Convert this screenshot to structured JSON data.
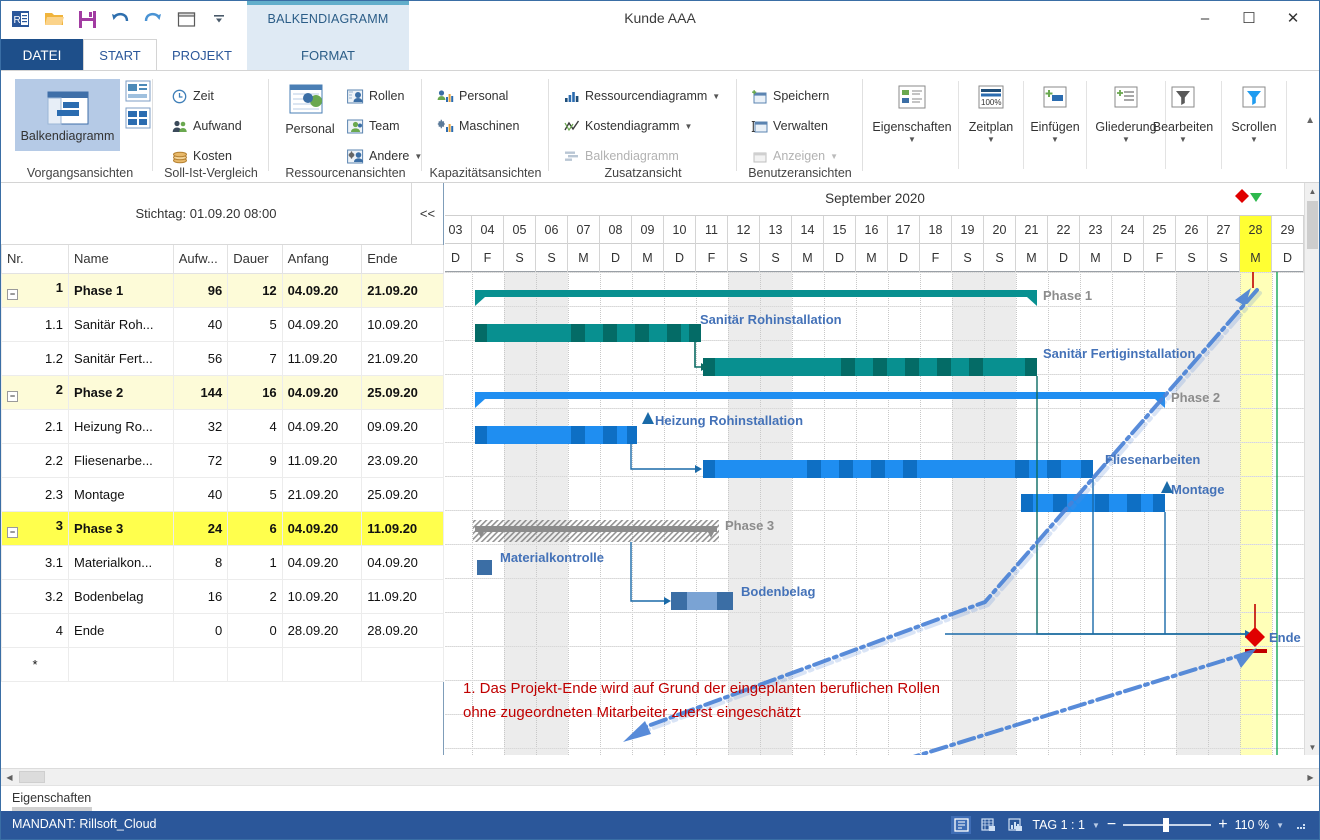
{
  "window": {
    "title": "Kunde AAA",
    "minimize": "–",
    "maximize": "☐",
    "close": "✕"
  },
  "quick_access": [
    {
      "name": "app-logo-icon",
      "label": "R"
    },
    {
      "name": "open-icon",
      "label": "Open"
    },
    {
      "name": "save-icon",
      "label": "Save"
    },
    {
      "name": "undo-icon",
      "label": "Undo"
    },
    {
      "name": "redo-icon",
      "label": "Redo"
    },
    {
      "name": "window-icon",
      "label": "Window"
    },
    {
      "name": "qat-more-icon",
      "label": "More"
    }
  ],
  "context_tab_group": "BALKENDIAGRAMM",
  "tabs": [
    {
      "label": "DATEI",
      "state": "file"
    },
    {
      "label": "START",
      "state": "active"
    },
    {
      "label": "PROJEKT",
      "state": "normal"
    },
    {
      "label": "FORMAT",
      "state": "context"
    }
  ],
  "ribbon": {
    "groups": [
      {
        "label": "Vorgangsansichten",
        "big": [
          {
            "label": "Balkendiagramm",
            "icon": "gantt-chart-icon",
            "selected": true
          }
        ],
        "small": []
      },
      {
        "label": "Soll-Ist-Vergleich",
        "big": [],
        "small": [
          {
            "label": "Zeit",
            "icon": "clock-icon"
          },
          {
            "label": "Aufwand",
            "icon": "people-icon"
          },
          {
            "label": "Kosten",
            "icon": "coins-icon"
          }
        ]
      },
      {
        "label": "Ressourcenansichten",
        "big": [
          {
            "label": "Personal",
            "icon": "staff-table-icon"
          }
        ],
        "small": [
          {
            "label": "Rollen",
            "icon": "roles-icon"
          },
          {
            "label": "Team",
            "icon": "team-icon"
          },
          {
            "label": "Andere",
            "icon": "other-icon",
            "caret": true
          }
        ]
      },
      {
        "label": "Kapazitätsansichten",
        "big": [],
        "small": [
          {
            "label": "Personal",
            "icon": "personnel-bars-icon"
          },
          {
            "label": "Maschinen",
            "icon": "machines-bars-icon"
          }
        ]
      },
      {
        "label": "Zusatzansicht",
        "big": [],
        "small": [
          {
            "label": "Ressourcendiagramm",
            "icon": "bar-chart-icon",
            "caret": true
          },
          {
            "label": "Kostendiagramm",
            "icon": "line-chart-icon",
            "caret": true
          },
          {
            "label": "Balkendiagramm",
            "icon": "gantt-small-icon",
            "disabled": true
          }
        ]
      },
      {
        "label": "Benutzeransichten",
        "big": [],
        "small": [
          {
            "label": "Speichern",
            "icon": "view-save-icon"
          },
          {
            "label": "Verwalten",
            "icon": "view-manage-icon"
          },
          {
            "label": "Anzeigen",
            "icon": "view-show-icon",
            "caret": true,
            "disabled": true
          }
        ]
      },
      {
        "label": "",
        "big": [
          {
            "label": "Eigenschaften",
            "icon": "properties-icon",
            "caret": true
          },
          {
            "label": "Zeitplan",
            "icon": "timeplan-icon",
            "caret": true
          },
          {
            "label": "Einfügen",
            "icon": "insert-icon",
            "caret": true
          },
          {
            "label": "Gliederung",
            "icon": "outline-icon",
            "caret": true
          },
          {
            "label": "Bearbeiten",
            "icon": "filter-icon",
            "caret": true
          },
          {
            "label": "Scrollen",
            "icon": "scroll-filter-icon",
            "caret": true
          }
        ],
        "small": []
      }
    ]
  },
  "table": {
    "stichtag": "Stichtag: 01.09.20 08:00",
    "collapse_label": "<<",
    "columns": [
      "Nr.",
      "Name",
      "Aufw...",
      "Dauer",
      "Anfang",
      "Ende"
    ],
    "rows": [
      {
        "nr": "1",
        "name": "Phase 1",
        "aufwand": "96",
        "dauer": "12",
        "anfang": "04.09.20",
        "ende": "21.09.20",
        "kind": "phase",
        "expander": "−"
      },
      {
        "nr": "1.1",
        "name": "Sanitär Roh...",
        "aufwand": "40",
        "dauer": "5",
        "anfang": "04.09.20",
        "ende": "10.09.20",
        "kind": "task"
      },
      {
        "nr": "1.2",
        "name": "Sanitär Fert...",
        "aufwand": "56",
        "dauer": "7",
        "anfang": "11.09.20",
        "ende": "21.09.20",
        "kind": "task"
      },
      {
        "nr": "2",
        "name": "Phase 2",
        "aufwand": "144",
        "dauer": "16",
        "anfang": "04.09.20",
        "ende": "25.09.20",
        "kind": "phase",
        "expander": "−"
      },
      {
        "nr": "2.1",
        "name": "Heizung Ro...",
        "aufwand": "32",
        "dauer": "4",
        "anfang": "04.09.20",
        "ende": "09.09.20",
        "kind": "task"
      },
      {
        "nr": "2.2",
        "name": "Fliesenarbe...",
        "aufwand": "72",
        "dauer": "9",
        "anfang": "11.09.20",
        "ende": "23.09.20",
        "kind": "task"
      },
      {
        "nr": "2.3",
        "name": "Montage",
        "aufwand": "40",
        "dauer": "5",
        "anfang": "21.09.20",
        "ende": "25.09.20",
        "kind": "task"
      },
      {
        "nr": "3",
        "name": "Phase 3",
        "aufwand": "24",
        "dauer": "6",
        "anfang": "04.09.20",
        "ende": "11.09.20",
        "kind": "phase3",
        "expander": "−"
      },
      {
        "nr": "3.1",
        "name": "Materialkon...",
        "aufwand": "8",
        "dauer": "1",
        "anfang": "04.09.20",
        "ende": "04.09.20",
        "kind": "task"
      },
      {
        "nr": "3.2",
        "name": "Bodenbelag",
        "aufwand": "16",
        "dauer": "2",
        "anfang": "10.09.20",
        "ende": "11.09.20",
        "kind": "task"
      },
      {
        "nr": "4",
        "name": "Ende",
        "aufwand": "0",
        "dauer": "0",
        "anfang": "28.09.20",
        "ende": "28.09.20",
        "kind": "task"
      },
      {
        "nr": "*",
        "name": "",
        "aufwand": "",
        "dauer": "",
        "anfang": "",
        "ende": "",
        "kind": "new"
      }
    ]
  },
  "gantt": {
    "month_label": "September 2020",
    "days": [
      "03",
      "04",
      "05",
      "06",
      "07",
      "08",
      "09",
      "10",
      "11",
      "12",
      "13",
      "14",
      "15",
      "16",
      "17",
      "18",
      "19",
      "20",
      "21",
      "22",
      "23",
      "24",
      "25",
      "26",
      "27",
      "28",
      "29"
    ],
    "weekdays": [
      "D",
      "F",
      "S",
      "S",
      "M",
      "D",
      "M",
      "D",
      "F",
      "S",
      "S",
      "M",
      "D",
      "M",
      "D",
      "F",
      "S",
      "S",
      "M",
      "D",
      "M",
      "D",
      "F",
      "S",
      "S",
      "M",
      "D"
    ],
    "highlight_day": "28",
    "bar_labels": [
      {
        "text": "Phase 1",
        "style": "grey"
      },
      {
        "text": "Sanitär Rohinstallation",
        "style": "blue"
      },
      {
        "text": "Sanitär Fertiginstallation",
        "style": "blue"
      },
      {
        "text": "Phase 2",
        "style": "grey"
      },
      {
        "text": "Heizung Rohinstallation",
        "style": "blue"
      },
      {
        "text": "Fliesenarbeiten",
        "style": "blue"
      },
      {
        "text": "Montage",
        "style": "blue"
      },
      {
        "text": "Phase 3",
        "style": "grey"
      },
      {
        "text": "Materialkontrolle",
        "style": "blue"
      },
      {
        "text": "Bodenbelag",
        "style": "blue"
      },
      {
        "text": "Ende",
        "style": "blue"
      }
    ],
    "annotation_line1": "1. Das Projekt-Ende wird auf Grund der eingeplanten beruflichen Rollen",
    "annotation_line2": "ohne zugeordneten Mitarbeiter zuerst eingeschätzt"
  },
  "properties_bar": {
    "label": "Eigenschaften"
  },
  "status": {
    "mandant": "MANDANT: Rillsoft_Cloud",
    "scale": "TAG 1 : 1",
    "zoom_minus": "−",
    "zoom_plus": "+",
    "zoom_value": "110 %"
  },
  "colors": {
    "accent_blue": "#2b579a",
    "teal_bar": "#089090",
    "teal_dark": "#046b66",
    "blue_bar": "#1f8ef1",
    "blue_dark": "#0e6fc4",
    "phase3_grey": "#8c8c8c",
    "milestone_red": "#e00000",
    "today_green": "#00a046",
    "annotation_red": "#c00000",
    "highlight_yellow": "#ffff33",
    "phase_row_yellow": "#fdfbd8"
  }
}
